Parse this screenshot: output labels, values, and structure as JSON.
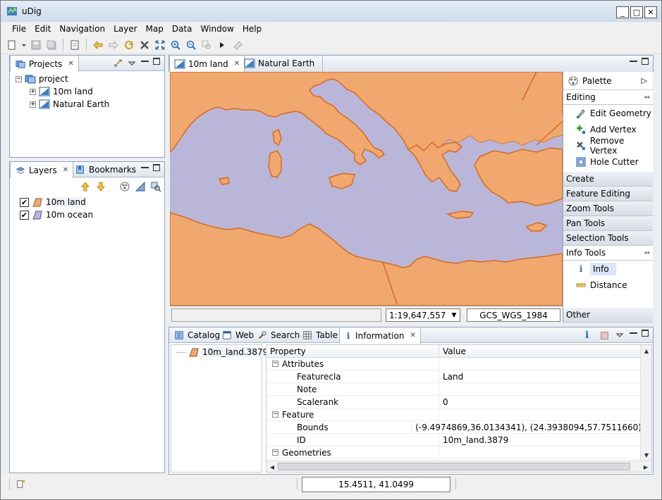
{
  "window": {
    "title": "uDig"
  },
  "menu": [
    "File",
    "Edit",
    "Navigation",
    "Layer",
    "Map",
    "Data",
    "Window",
    "Help"
  ],
  "projects_panel": {
    "tab_label": "Projects",
    "root": "project",
    "children": [
      "10m land",
      "Natural Earth"
    ]
  },
  "layers_panel": {
    "tabs": [
      "Layers",
      "Bookmarks"
    ],
    "layers": [
      {
        "name": "10m land",
        "checked": true,
        "color": "#f0a86e"
      },
      {
        "name": "10m ocean",
        "checked": true,
        "color": "#b9b6d9"
      }
    ]
  },
  "map_tabs": [
    "10m land",
    "Natural Earth"
  ],
  "map_status": {
    "scale": "1:19,647,557",
    "crs": "GCS_WGS_1984"
  },
  "palette": {
    "title": "Palette",
    "drawers": [
      {
        "label": "Editing",
        "open": true,
        "tools": [
          "Edit Geometry",
          "Add Vertex",
          "Remove Vertex",
          "Hole Cutter"
        ]
      },
      {
        "label": "Create",
        "open": false
      },
      {
        "label": "Feature Editing",
        "open": false
      },
      {
        "label": "Zoom Tools",
        "open": false
      },
      {
        "label": "Pan Tools",
        "open": false
      },
      {
        "label": "Selection Tools",
        "open": false
      },
      {
        "label": "Info Tools",
        "open": true,
        "tools": [
          "Info",
          "Distance"
        ],
        "selected": "Info"
      },
      {
        "label": "Other",
        "open": false
      }
    ]
  },
  "bottom_tabs": [
    "Catalog",
    "Web",
    "Search",
    "Table",
    "Information"
  ],
  "info": {
    "feature": "10m_land.3879",
    "columns": [
      "Property",
      "Value"
    ],
    "rows": [
      {
        "group": true,
        "property": "Attributes",
        "value": ""
      },
      {
        "group": false,
        "property": "Featurecla",
        "value": "Land"
      },
      {
        "group": false,
        "property": "Note",
        "value": ""
      },
      {
        "group": false,
        "property": "Scalerank",
        "value": "0"
      },
      {
        "group": true,
        "property": "Feature",
        "value": ""
      },
      {
        "group": false,
        "property": "Bounds",
        "value": "(-9.4974869,36.0134341), (24.3938094,57.7511660)"
      },
      {
        "group": false,
        "property": "ID",
        "value": "10m_land.3879"
      },
      {
        "group": true,
        "property": "Geometries",
        "value": ""
      }
    ]
  },
  "statusbar": {
    "coordinates": "15.4511, 41.0499"
  },
  "colors": {
    "land": "#f0a86e",
    "ocean": "#b9b6d9",
    "coast": "#d86a1a"
  }
}
